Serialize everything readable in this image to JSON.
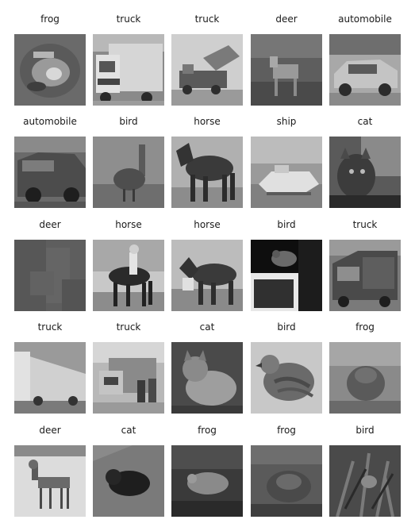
{
  "cells": [
    {
      "label": "frog"
    },
    {
      "label": "truck"
    },
    {
      "label": "truck"
    },
    {
      "label": "deer"
    },
    {
      "label": "automobile"
    },
    {
      "label": "automobile"
    },
    {
      "label": "bird"
    },
    {
      "label": "horse"
    },
    {
      "label": "ship"
    },
    {
      "label": "cat"
    },
    {
      "label": "deer"
    },
    {
      "label": "horse"
    },
    {
      "label": "horse"
    },
    {
      "label": "bird"
    },
    {
      "label": "truck"
    },
    {
      "label": "truck"
    },
    {
      "label": "truck"
    },
    {
      "label": "cat"
    },
    {
      "label": "bird"
    },
    {
      "label": "frog"
    },
    {
      "label": "deer"
    },
    {
      "label": "cat"
    },
    {
      "label": "frog"
    },
    {
      "label": "frog"
    },
    {
      "label": "bird"
    }
  ]
}
